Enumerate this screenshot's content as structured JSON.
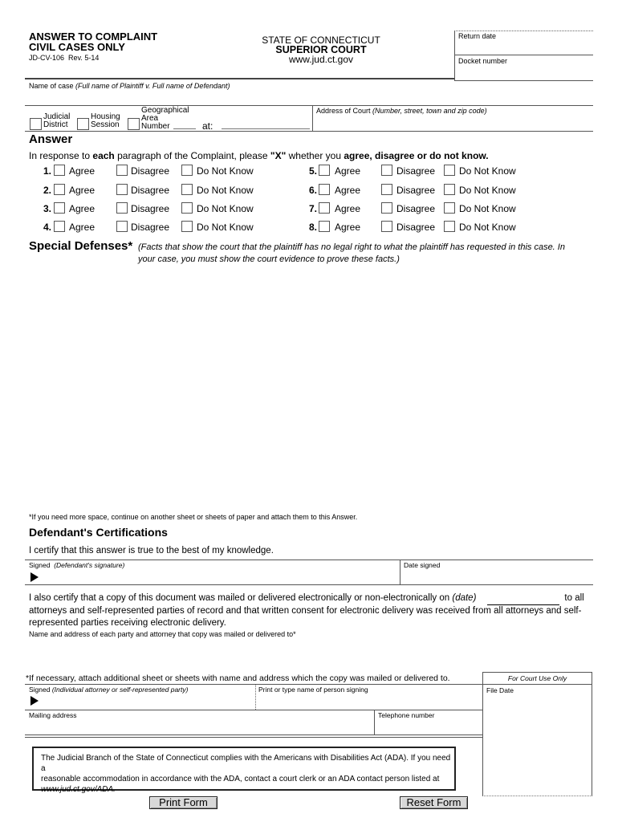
{
  "header": {
    "title_line1": "ANSWER TO COMPLAINT",
    "title_line2": "CIVIL CASES ONLY",
    "form_id": "JD-CV-106",
    "revision": "Rev. 5-14",
    "state": "STATE OF CONNECTICUT",
    "court": "SUPERIOR COURT",
    "website": "www.jud.ct.gov",
    "return_date_label": "Return date",
    "docket_number_label": "Docket number"
  },
  "case": {
    "name_label": "Name of case",
    "name_hint": "(Full name of Plaintiff v. Full name of Defendant)",
    "judicial_district_line1": "Judicial",
    "judicial_district_line2": "District",
    "housing_session_line1": "Housing",
    "housing_session_line2": "Session",
    "ga_line1": "Geographical",
    "ga_line2": "Area",
    "ga_line3": "Number",
    "at_label": "at:",
    "address_label": "Address of Court",
    "address_hint": "(Number, street, town and zip code)"
  },
  "answer": {
    "heading": "Answer",
    "instruction_part1": "In response to",
    "instruction_bold1": "each",
    "instruction_part2": " paragraph of the Complaint, please",
    "instruction_bold2": "\"X\"",
    "instruction_part3": " whether you",
    "instruction_bold3": "agree, disagree or do not know.",
    "options": [
      "Agree",
      "Disagree",
      "Do Not Know"
    ],
    "paragraphs": [
      "1.",
      "2.",
      "3.",
      "4.",
      "5.",
      "6.",
      "7.",
      "8."
    ]
  },
  "special_defenses": {
    "heading": "Special Defenses*",
    "hint_line1": "(Facts that show the court that the plaintiff has no legal right to what the plaintiff has requested in this case. In",
    "hint_line2": "your case, you must show the court evidence to prove these facts.)",
    "footnote": "*If you need more space, continue on another sheet or sheets of paper and attach them to this Answer."
  },
  "certifications": {
    "heading": "Defendant's Certifications",
    "statement": "I certify that this answer is true to the best of my knowledge.",
    "signed_label": "Signed",
    "signed_hint": "(Defendant's signature)",
    "date_signed_label": "Date signed",
    "copy_line1a": "I also certify that a copy of this document was mailed or delivered electronically or non-electronically on",
    "copy_date_hint": "(date)",
    "copy_line1b": "to all",
    "copy_line2": "attorneys and self-represented parties of record and that written consent for electronic delivery was received from all attorneys and self-",
    "copy_line3": "represented parties receiving electronic delivery.",
    "name_address_label": "Name and address of each party and attorney that copy was mailed or delivered to*",
    "attach_note": "*If necessary, attach additional sheet or sheets with name and address which the copy was mailed or delivered to.",
    "signed2_label": "Signed",
    "signed2_hint": "(Individual attorney or self-represented party)",
    "print_name_label": "Print or type name of person signing",
    "mailing_address_label": "Mailing address",
    "telephone_label": "Telephone number"
  },
  "court_use": {
    "heading": "For Court Use Only",
    "file_date_label": "File Date"
  },
  "ada": {
    "line1": "The Judicial Branch of the State of Connecticut complies with the Americans with Disabilities Act (ADA). If you need a",
    "line2": "reasonable accommodation in accordance with the ADA, contact a court clerk or an ADA contact person listed at",
    "line3": "www.jud.ct.gov/ADA."
  },
  "buttons": {
    "print": "Print Form",
    "reset": "Reset Form"
  }
}
